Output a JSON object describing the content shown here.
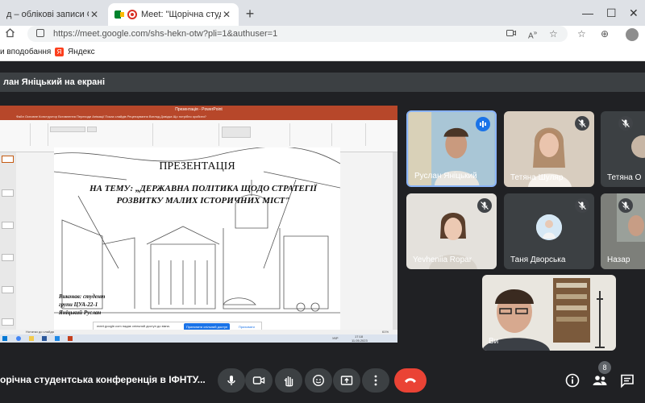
{
  "browser": {
    "tabs": [
      {
        "title": "д – облікові записи Google"
      },
      {
        "title": "Meet: \"Щорічна студентсь"
      }
    ],
    "url": "https://meet.google.com/shs-hekn-otw?pli=1&authuser=1",
    "bookmarks": [
      "и вподобання",
      "Яндекс"
    ]
  },
  "meet": {
    "presenter_banner": "лан Яніцький на екрані",
    "meeting_title": "орічна студентська конференція в ІФНТУ...",
    "participant_count": "8",
    "participants": [
      {
        "name": "Руслан Яніцький",
        "speaking": true
      },
      {
        "name": "Тетяна Шуляр",
        "muted": true
      },
      {
        "name": "Тетяна О",
        "muted": true
      },
      {
        "name": "Yevheniia Ropar",
        "muted": true
      },
      {
        "name": "Таня Дворська",
        "muted": true
      },
      {
        "name": "Назар",
        "muted": true
      },
      {
        "name": "Ви"
      }
    ]
  },
  "presentation": {
    "app_title": "Презентація - PowerPoint",
    "menu": "Файл   Основне   Конструктор   Вставлення   Переходи   Анімації   Показ слайдів   Рецензування   Вигляд   Довідка   Що потрібно зробити?",
    "slide_title": "ПРЕЗЕНТАЦІЯ",
    "slide_subtitle": "НА ТЕМУ: „ДЕРЖАВНА ПОЛІТИКА ЩОДО СТРАТЕГІЇ РОЗВИТКУ МАЛИХ ІСТОРИЧНИХ МІСТ\"",
    "author_line1": "Виконав: студент",
    "author_line2": "групи ЦУА-22-1",
    "author_line3": "Яніцький Руслан",
    "share_notice": "meet.google.com надає спільний доступ до вікна.",
    "share_button": "Припинити спільний доступ",
    "hide_button": "Приховати",
    "notes_placeholder": "Нотатки до слайда",
    "clock_time": "17:18",
    "clock_date": "11.05.2023",
    "lang": "УКР",
    "zoom": "61%"
  },
  "colors": {
    "meet_bg": "#202124",
    "tile_bg": "#3c4043",
    "end_call": "#ea4335",
    "ppt_accent": "#b7472a",
    "active_speaker": "#8ab4f8"
  }
}
